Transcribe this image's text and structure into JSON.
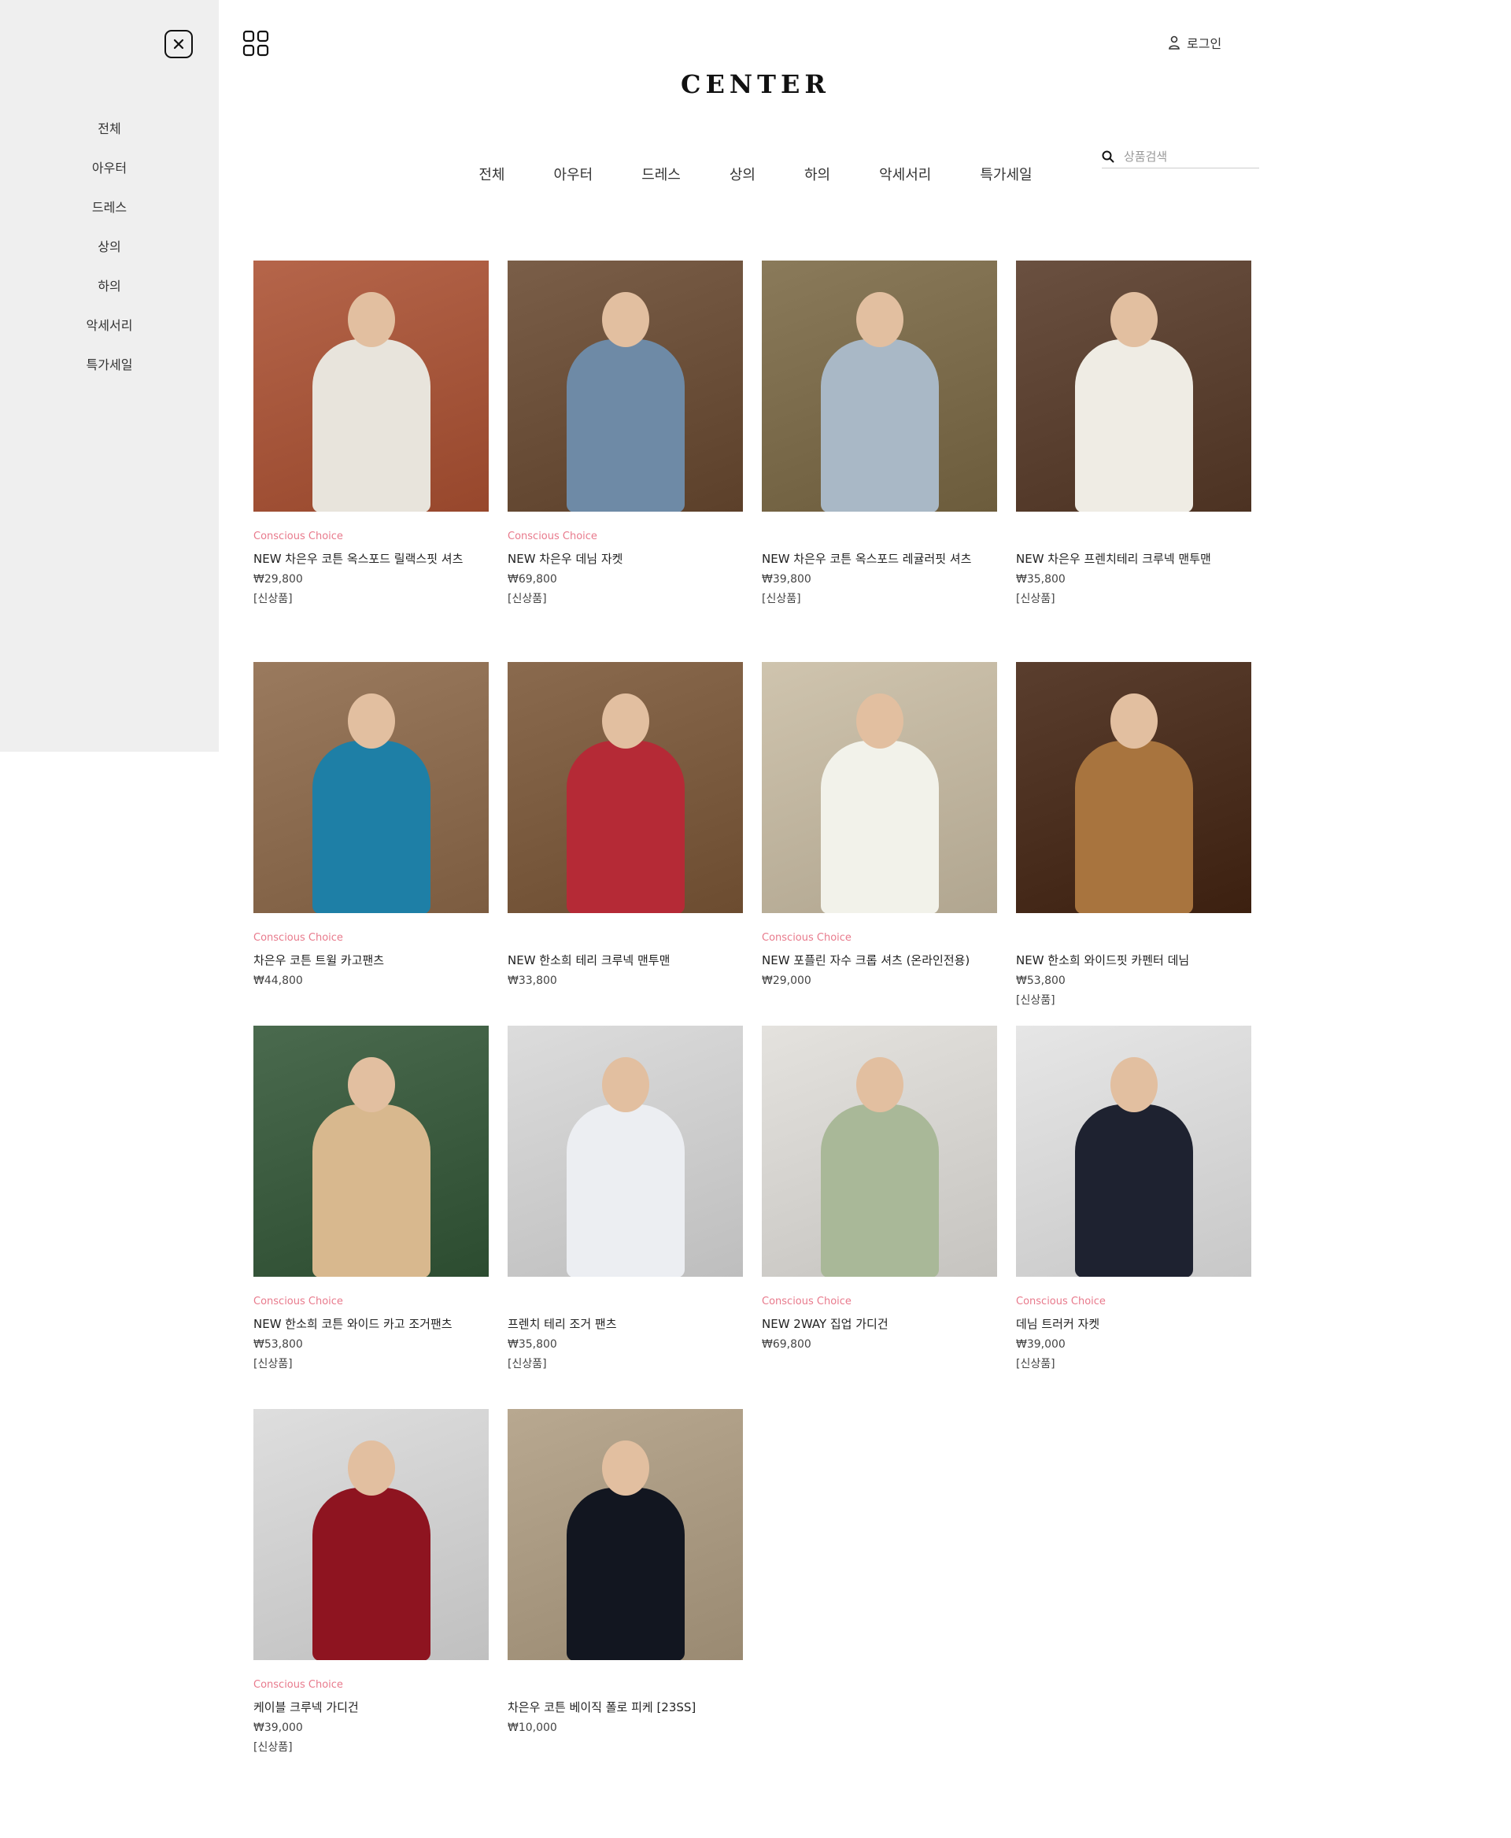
{
  "drawer": {
    "close_icon": "close-icon",
    "items": [
      "전체",
      "아우터",
      "드레스",
      "상의",
      "하의",
      "악세서리",
      "특가세일"
    ]
  },
  "header": {
    "grid_icon": "grid-icon",
    "login_label": "로그인",
    "logo": "CENTER",
    "search_placeholder": "상품검색"
  },
  "nav": [
    "전체",
    "아우터",
    "드레스",
    "상의",
    "하의",
    "악세서리",
    "특가세일"
  ],
  "colors": {
    "drawer_bg": "#efefef",
    "badge": "#e87a8c"
  },
  "products": [
    {
      "badge": "Conscious Choice",
      "name": "NEW 차은우 코튼 옥스포드 릴랙스핏 셔츠",
      "price": "₩29,800",
      "tag": "[신상품]",
      "bg": "#b5654a",
      "fig": "#e8e4dc"
    },
    {
      "badge": "Conscious Choice",
      "name": "NEW 차은우 데님 자켓",
      "price": "₩69,800",
      "tag": "[신상품]",
      "bg": "#7a5e48",
      "fig": "#6e8aa6"
    },
    {
      "badge": "",
      "name": "NEW 차은우 코튼 옥스포드 레귤러핏 셔츠",
      "price": "₩39,800",
      "tag": "[신상품]",
      "bg": "#8a7a5a",
      "fig": "#a9b8c6"
    },
    {
      "badge": "",
      "name": "NEW 차은우 프렌치테리 크루넥 맨투맨",
      "price": "₩35,800",
      "tag": "[신상품]",
      "bg": "#6a5040",
      "fig": "#efece4"
    },
    {
      "badge": "Conscious Choice",
      "name": "차은우 코튼 트윌 카고팬츠",
      "price": "₩44,800",
      "tag": "",
      "bg": "#9a7a5e",
      "fig": "#1e7fa6"
    },
    {
      "badge": "",
      "name": "NEW 한소희 테리 크루넥 맨투맨",
      "price": "₩33,800",
      "tag": "",
      "bg": "#8a6a4e",
      "fig": "#b52a36"
    },
    {
      "badge": "Conscious Choice",
      "name": "NEW 포플린 자수 크롭 셔츠 (온라인전용)",
      "price": "₩29,000",
      "tag": "",
      "bg": "#cfc4ae",
      "fig": "#f2f2ea"
    },
    {
      "badge": "",
      "name": "NEW 한소희 와이드핏 카펜터 데님",
      "price": "₩53,800",
      "tag": "[신상품]",
      "bg": "#5a3e2e",
      "fig": "#a8743e"
    },
    {
      "badge": "Conscious Choice",
      "name": "NEW 한소희 코튼 와이드 카고 조거팬츠",
      "price": "₩53,800",
      "tag": "[신상품]",
      "bg": "#4a6a4e",
      "fig": "#d8b88e"
    },
    {
      "badge": "",
      "name": "프렌치 테리 조거 팬츠",
      "price": "₩35,800",
      "tag": "[신상품]",
      "bg": "#dcdcdc",
      "fig": "#eceef2"
    },
    {
      "badge": "Conscious Choice",
      "name": "NEW 2WAY 집업 가디건",
      "price": "₩69,800",
      "tag": "",
      "bg": "#e4e2de",
      "fig": "#a9b898"
    },
    {
      "badge": "Conscious Choice",
      "name": "데님 트러커 자켓",
      "price": "₩39,000",
      "tag": "[신상품]",
      "bg": "#e6e6e6",
      "fig": "#1e2230"
    },
    {
      "badge": "Conscious Choice",
      "name": "케이블 크루넥 가디건",
      "price": "₩39,000",
      "tag": "[신상품]",
      "bg": "#dedede",
      "fig": "#8e1420"
    },
    {
      "badge": "",
      "name": "차은우 코튼 베이직 폴로 피케 [23SS]",
      "price": "₩10,000",
      "tag": "",
      "bg": "#b8a890",
      "fig": "#121620"
    }
  ]
}
